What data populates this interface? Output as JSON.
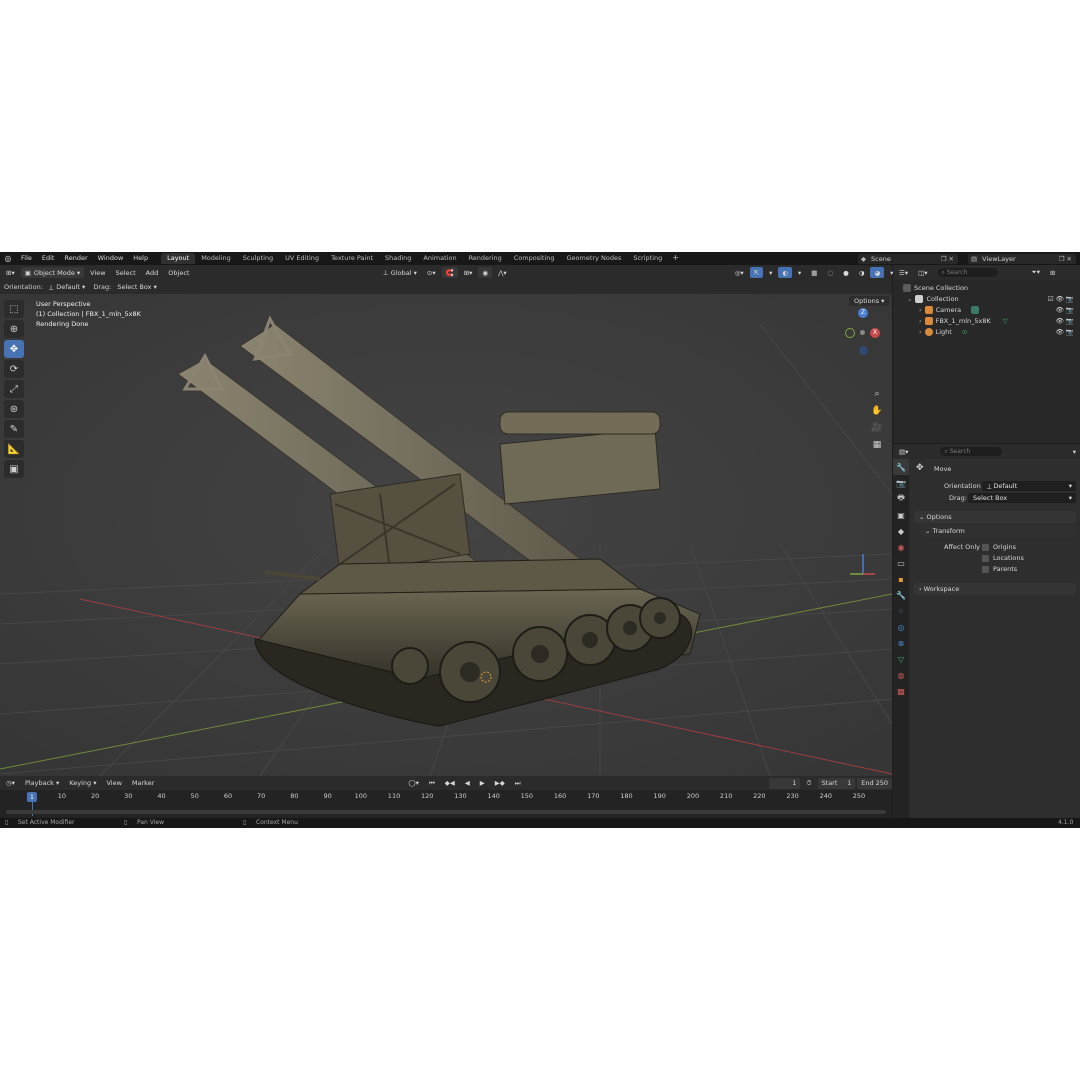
{
  "menu": [
    "File",
    "Edit",
    "Render",
    "Window",
    "Help"
  ],
  "workspaces": [
    "Layout",
    "Modeling",
    "Sculpting",
    "UV Editing",
    "Texture Paint",
    "Shading",
    "Animation",
    "Rendering",
    "Compositing",
    "Geometry Nodes",
    "Scripting"
  ],
  "active_workspace": "Layout",
  "scene": "Scene",
  "view_layer": "ViewLayer",
  "viewport_header": {
    "mode": "Object Mode",
    "items": [
      "View",
      "Select",
      "Add",
      "Object"
    ],
    "transform_orientation": "Global"
  },
  "tool_settings": {
    "orientation_label": "Orientation:",
    "orientation_value": "Default",
    "drag_label": "Drag:",
    "drag_value": "Select Box",
    "options": "Options"
  },
  "viewport_info": {
    "line1": "User Perspective",
    "line2": "(1) Collection | FBX_1_mln_5x8K",
    "line3": "Rendering Done"
  },
  "gizmo": {
    "z": "Z",
    "x": "X"
  },
  "timeline": {
    "menu": [
      "Playback",
      "Keying",
      "View",
      "Marker"
    ],
    "current_frame": "1",
    "start_label": "Start",
    "start": "1",
    "end_label": "End",
    "end": "250",
    "ruler": [
      "10",
      "20",
      "30",
      "40",
      "50",
      "60",
      "70",
      "80",
      "90",
      "100",
      "110",
      "120",
      "130",
      "140",
      "150",
      "160",
      "170",
      "180",
      "190",
      "200",
      "210",
      "220",
      "230",
      "240",
      "250"
    ],
    "cursor_label": "1"
  },
  "status_bar": {
    "left": "Set Active Modifier",
    "middle": "Pan View",
    "right": "Context Menu",
    "version": "4.1.0"
  },
  "outliner": {
    "search_placeholder": "Search",
    "scene_collection": "Scene Collection",
    "collection": "Collection",
    "items": [
      "Camera",
      "FBX_1_mln_5x8K",
      "Light"
    ]
  },
  "properties": {
    "search_placeholder": "Search",
    "tool_name": "Move",
    "orientation_label": "Orientation",
    "orientation_value": "Default",
    "drag_label": "Drag:",
    "drag_value": "Select Box",
    "options_panel": "Options",
    "transform_panel": "Transform",
    "affect_only_label": "Affect Only",
    "affect_only": [
      "Origins",
      "Locations",
      "Parents"
    ],
    "workspace_panel": "Workspace"
  },
  "colors": {
    "accent": "#4772b3",
    "axis_x": "#c84a4a",
    "axis_y": "#7fa83a",
    "axis_z": "#4a7fd0"
  }
}
